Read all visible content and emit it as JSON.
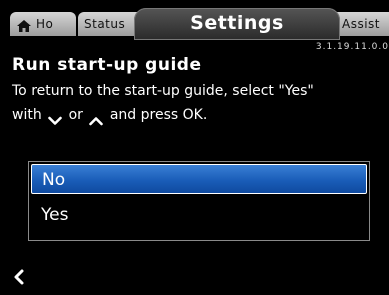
{
  "tabs": {
    "home": "Ho",
    "status": "Status",
    "settings": "Settings",
    "assist": "Assist"
  },
  "version": "3.1.19.11.0.0",
  "title": "Run start-up guide",
  "description": {
    "line1": "To return to the start-up guide, select \"Yes\"",
    "with": "with",
    "or": "or",
    "end": "and press OK."
  },
  "options": [
    "No",
    "Yes"
  ],
  "selected_index": 0,
  "icons": {
    "home": "home-icon",
    "down": "chevron-down-icon",
    "up": "chevron-up-icon",
    "back": "chevron-left-icon"
  }
}
